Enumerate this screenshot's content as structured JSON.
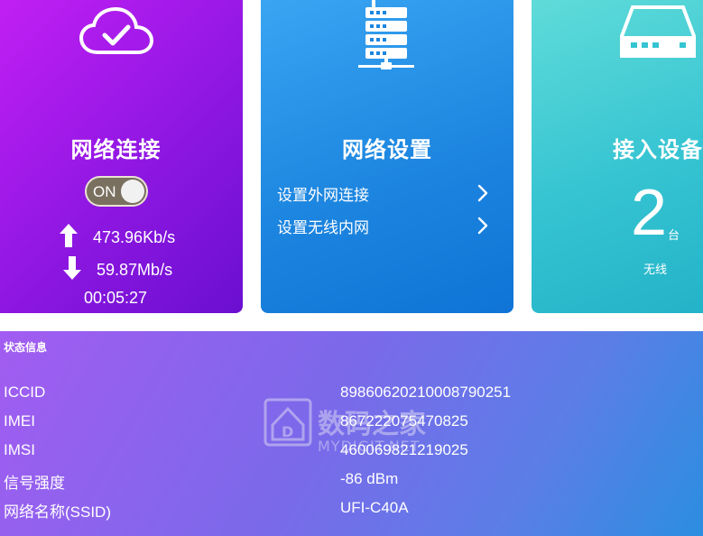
{
  "cards": {
    "network": {
      "title": "网络连接",
      "toggle_label": "ON",
      "upload_speed": "473.96Kb/s",
      "download_speed": "59.87Mb/s",
      "uptime": "00:05:27"
    },
    "settings": {
      "title": "网络设置",
      "items": [
        "设置外网连接",
        "设置无线内网"
      ]
    },
    "devices": {
      "title": "接入设备",
      "count": "2",
      "unit": "台",
      "kind": "无线"
    }
  },
  "status": {
    "title": "状态信息",
    "rows": [
      {
        "label": "ICCID",
        "value": "89860620210008790251"
      },
      {
        "label": "IMEI",
        "value": "867222075470825"
      },
      {
        "label": "IMSI",
        "value": "460069821219025"
      },
      {
        "label": "信号强度",
        "value": "-86 dBm"
      },
      {
        "label": "网络名称(SSID)",
        "value": "UFI-C40A"
      }
    ]
  },
  "watermark": {
    "text": "数码之家",
    "sub": "MYDIGIT.NET"
  },
  "colors": {
    "network_card": "#9b16e6",
    "settings_card": "#1d86e0",
    "devices_card": "#36c4d2",
    "status_panel": "#7b69ea"
  }
}
